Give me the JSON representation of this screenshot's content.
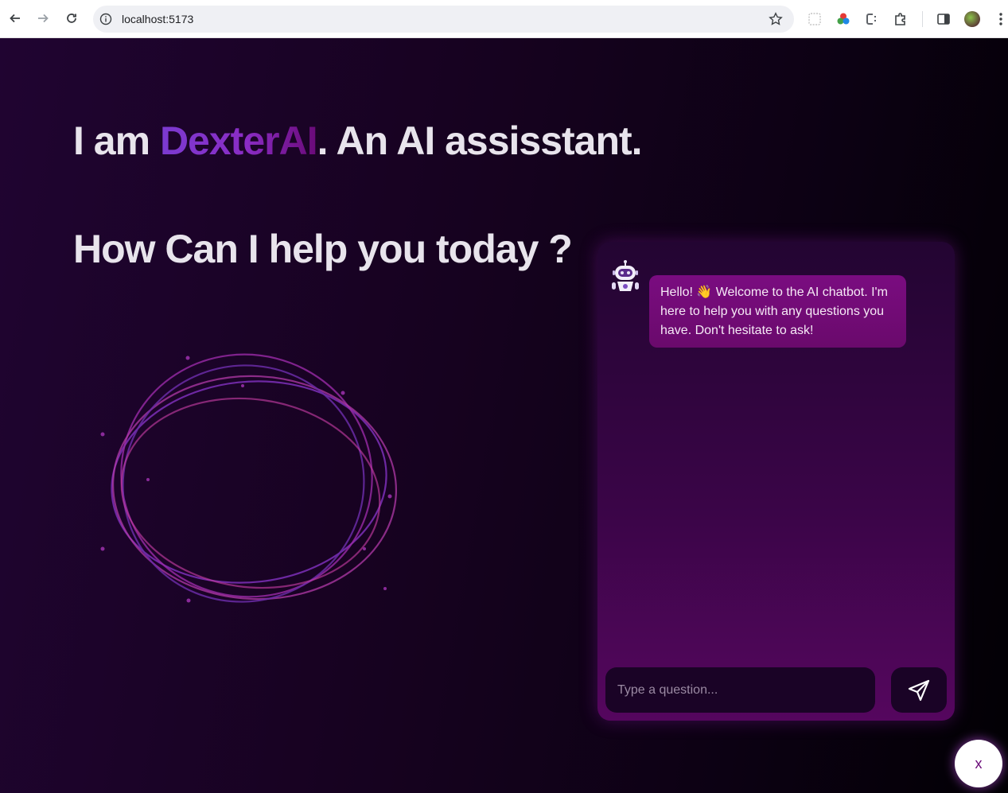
{
  "browser": {
    "url": "localhost:5173"
  },
  "hero": {
    "prefix": "I am ",
    "brand": "DexterAI",
    "suffix": ". An AI assisstant.",
    "question": "How Can I help you today ?"
  },
  "chat": {
    "welcome_message": "Hello! 👋 Welcome to the AI chatbot. I'm here to help you with any questions you have. Don't hesitate to ask!",
    "input_placeholder": "Type a question...",
    "input_value": ""
  },
  "close_label": "x",
  "colors": {
    "accent": "#7b3ad0",
    "bubble": "#7a0c80",
    "background": "#14011f"
  }
}
